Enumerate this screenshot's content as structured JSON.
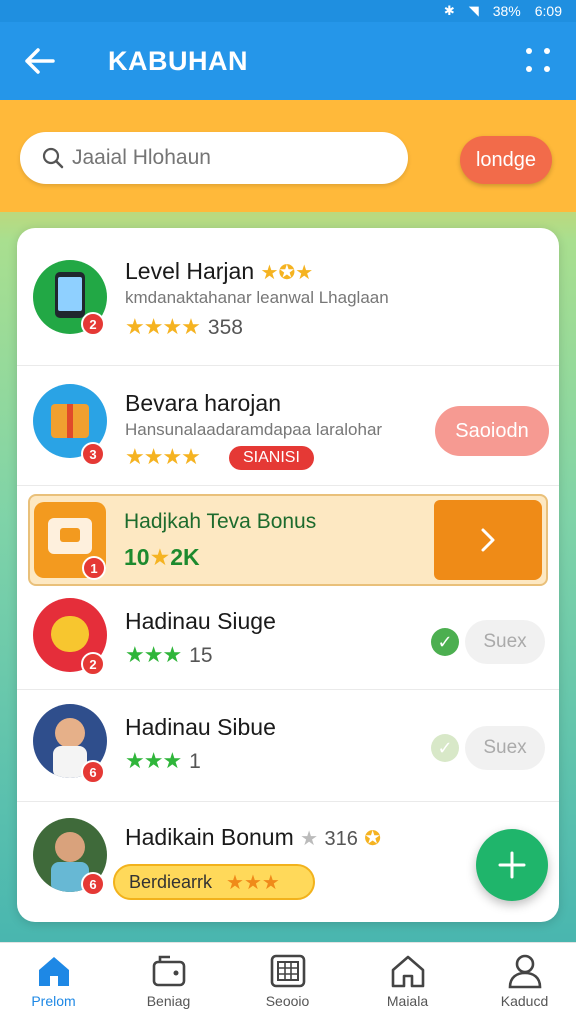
{
  "status_bar": {
    "battery": "38%",
    "time": "6:09"
  },
  "app_bar": {
    "title": "KABUHAN"
  },
  "search": {
    "placeholder": "Jaaial Hlohaun",
    "button_label": "londge"
  },
  "list": [
    {
      "title": "Level Harjan",
      "subtitle": "kmdanaktahanar leanwal Lhaglaan",
      "badge": "2",
      "rating_text": "358"
    },
    {
      "title": "Bevara harojan",
      "subtitle": "Hansunalaadaramdapaa laralohar",
      "badge": "3",
      "tag": "SIANISI",
      "action": "Saoiodn"
    },
    {
      "title": "Hadinau Siuge",
      "badge": "2",
      "rating_text": "15",
      "action": "Suex"
    },
    {
      "title": "Hadinau Sibue",
      "badge": "6",
      "rating_text": "1",
      "action": "Suex"
    },
    {
      "title": "Hadikain Bonum",
      "badge": "6",
      "rating_text": "316",
      "pill": "Berdiearrk"
    }
  ],
  "bonus": {
    "title": "Hadjkah Teva Bonus",
    "value": "10",
    "value_suffix": "2K",
    "badge": "1"
  },
  "bottom_nav": [
    {
      "label": "Prelom",
      "icon": "home-icon",
      "active": true
    },
    {
      "label": "Beniag",
      "icon": "wallet-icon"
    },
    {
      "label": "Seooio",
      "icon": "calendar-icon"
    },
    {
      "label": "Maiala",
      "icon": "house-icon"
    },
    {
      "label": "Kaducd",
      "icon": "profile-icon"
    }
  ],
  "colors": {
    "primary": "#2596e9",
    "accent_orange": "#ef8b17",
    "fab_green": "#1fb56b",
    "badge_red": "#e53935"
  }
}
